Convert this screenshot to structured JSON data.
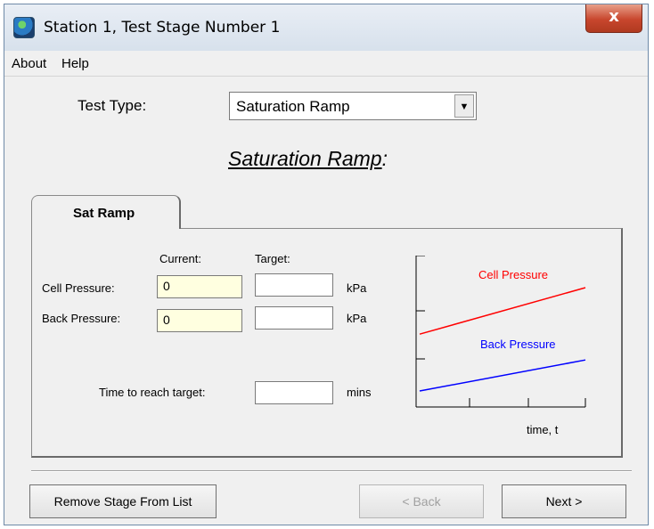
{
  "window": {
    "title": "Station 1, Test Stage Number 1",
    "close_label": "x"
  },
  "menu": {
    "items": [
      "About",
      "Help"
    ]
  },
  "test_type": {
    "label": "Test Type:",
    "selected": "Saturation Ramp",
    "dropdown_arrow": "▼"
  },
  "stage_heading": {
    "text": "Saturation Ramp",
    "suffix": ":"
  },
  "tabs": [
    {
      "label": "Sat Ramp"
    }
  ],
  "panel": {
    "col_current": "Current:",
    "col_target": "Target:",
    "cell_pressure": {
      "label": "Cell Pressure:",
      "current": "0",
      "target": "",
      "unit": "kPa"
    },
    "back_pressure": {
      "label": "Back Pressure:",
      "current": "0",
      "target": "",
      "unit": "kPa"
    },
    "time": {
      "label": "Time to reach target:",
      "value": "",
      "unit": "mins"
    }
  },
  "chart": {
    "series": [
      {
        "name": "Cell Pressure",
        "color": "#ff0000"
      },
      {
        "name": "Back Pressure",
        "color": "#0000ff"
      }
    ],
    "xlabel": "time, t"
  },
  "chart_data": {
    "type": "line",
    "xlabel": "time, t",
    "ylabel": "",
    "grid": false,
    "series": [
      {
        "name": "Cell Pressure",
        "x": [
          0,
          1
        ],
        "y": [
          0.55,
          1.0
        ]
      },
      {
        "name": "Back Pressure",
        "x": [
          0,
          1
        ],
        "y": [
          0.0,
          0.3
        ]
      }
    ]
  },
  "buttons": {
    "remove": "Remove Stage From List",
    "back": "< Back",
    "next": "Next >"
  }
}
